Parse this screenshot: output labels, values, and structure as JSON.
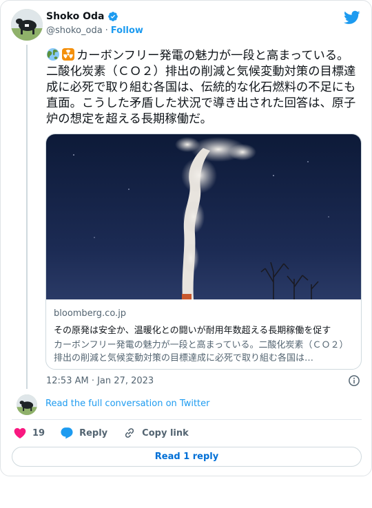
{
  "author": {
    "name": "Shoko Oda",
    "handle": "@shoko_oda",
    "separator": "·",
    "follow_label": "Follow",
    "verified": true
  },
  "tweet": {
    "emojis": [
      "globe-asia-australia-icon",
      "radioactive-icon"
    ],
    "text": "カーボンフリー発電の魅力が一段と高まっている。二酸化炭素（ＣＯ２）排出の削減と気候変動対策の目標達成に必死で取り組む各国は、伝統的な化石燃料の不足にも直面。こうした矛盾した状況で導き出された回答は、原子炉の想定を超える長期稼働だ。"
  },
  "link_card": {
    "domain": "bloomberg.co.jp",
    "title": "その原発は安全か、温暖化との闘いが耐用年数超える長期稼働を促す",
    "description": "カーボンフリー発電の魅力が一段と高まっている。二酸化炭素（ＣＯ２）排出の削減と気候変動対策の目標達成に必死で取り組む各国は…"
  },
  "timestamp": "12:53 AM · Jan 27, 2023",
  "read_full_label": "Read the full conversation on Twitter",
  "actions": {
    "like_count": "19",
    "reply_label": "Reply",
    "copy_link_label": "Copy link"
  },
  "read_reply_label": "Read 1 reply",
  "colors": {
    "accent": "#1d9bf0",
    "like": "#f91880",
    "text": "#0f1419",
    "muted": "#536471"
  }
}
